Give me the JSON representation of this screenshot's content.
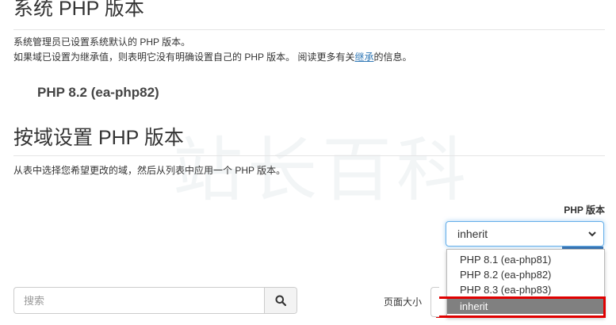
{
  "system": {
    "title": "系统 PHP 版本",
    "line1": "系统管理员已设置系统默认的 PHP 版本。",
    "line2_pre": "如果域已设置为继承值，则表明它没有明确设置自己的 PHP 版本。 阅读更多有关",
    "line2_link": "继承",
    "line2_post": "的信息。",
    "current_version": "PHP 8.2 (ea-php82)"
  },
  "domain_section": {
    "title": "按域设置 PHP 版本",
    "description": "从表中选择您希望更改的域，然后从列表中应用一个 PHP 版本。"
  },
  "watermark": "站长百科",
  "php_select": {
    "label": "PHP 版本",
    "value": "inherit",
    "options": [
      "PHP 8.1 (ea-php81)",
      "PHP 8.2 (ea-php82)",
      "PHP 8.3 (ea-php83)",
      "inherit"
    ],
    "selected_option": "inherit"
  },
  "search": {
    "placeholder": "搜索"
  },
  "page_size": {
    "label": "页面大小"
  },
  "colors": {
    "highlight": "#e00000",
    "link": "#337ab7",
    "selected_bg": "#808080"
  },
  "icons": {
    "search": "search-icon",
    "dropdown": "chevron-down-icon"
  }
}
